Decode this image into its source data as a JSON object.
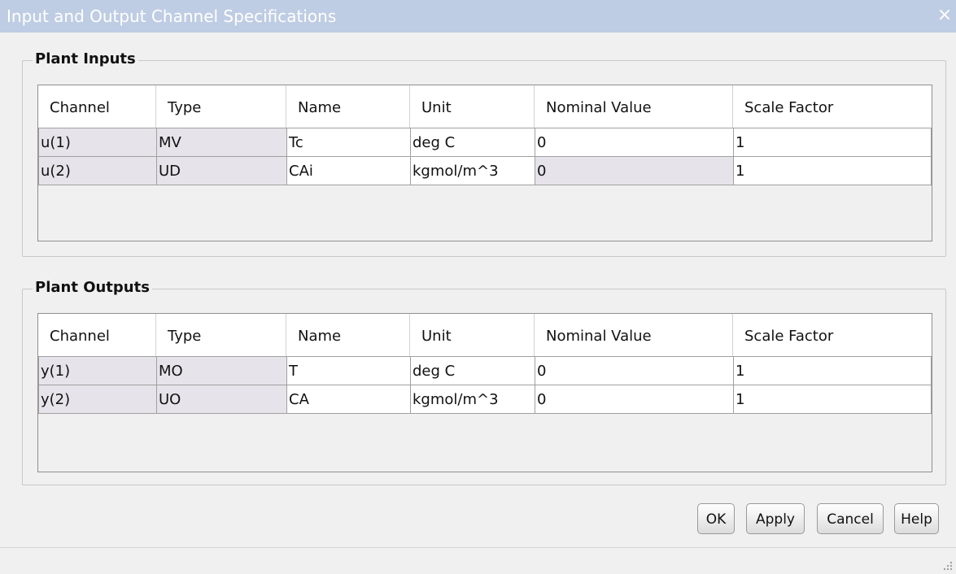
{
  "window": {
    "title": "Input and Output Channel Specifications",
    "close_glyph": "×"
  },
  "columns": [
    "Channel",
    "Type",
    "Name",
    "Unit",
    "Nominal Value",
    "Scale Factor"
  ],
  "inputs": {
    "title": "Plant Inputs",
    "rows": [
      [
        "u(1)",
        "MV",
        "Tc",
        "deg C",
        "0",
        "1"
      ],
      [
        "u(2)",
        "UD",
        "CAi",
        "kgmol/m^3",
        "0",
        "1"
      ]
    ]
  },
  "outputs": {
    "title": "Plant Outputs",
    "rows": [
      [
        "y(1)",
        "MO",
        "T",
        "deg C",
        "0",
        "1"
      ],
      [
        "y(2)",
        "UO",
        "CA",
        "kgmol/m^3",
        "0",
        "1"
      ]
    ]
  },
  "buttons": {
    "ok": "OK",
    "apply": "Apply",
    "cancel": "Cancel",
    "help": "Help"
  },
  "colors": {
    "titlebar": "#bfcde4",
    "readonly_cell": "#e6e4ea"
  }
}
